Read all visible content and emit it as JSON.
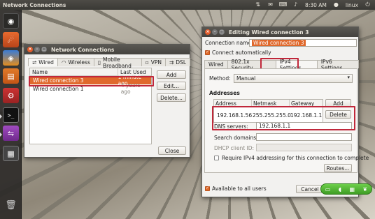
{
  "top_panel": {
    "title": "Network Connections",
    "time": "8:30 AM",
    "user": "linux"
  },
  "nc_window": {
    "title": "Network Connections",
    "tabs": [
      "Wired",
      "Wireless",
      "Mobile Broadband",
      "VPN",
      "DSL"
    ],
    "columns": [
      "Name",
      "Last Used"
    ],
    "rows": [
      {
        "name": "Wired connection 3",
        "last_used": "1 minute ago",
        "selected": true
      },
      {
        "name": "Wired connection 1",
        "last_used": "4 years ago",
        "selected": false
      }
    ],
    "buttons": {
      "add": "Add",
      "edit": "Edit...",
      "delete": "Delete...",
      "close": "Close"
    }
  },
  "edit_window": {
    "title": "Editing Wired connection 3",
    "connection_name_label": "Connection name:",
    "connection_name": "Wired connection 3",
    "connect_auto": "Connect automatically",
    "tabs": [
      "Wired",
      "802.1x Security",
      "IPv4 Settings",
      "IPv6 Settings"
    ],
    "method_label": "Method:",
    "method_value": "Manual",
    "addresses_label": "Addresses",
    "addr_columns": [
      "Address",
      "Netmask",
      "Gateway"
    ],
    "addr_row": {
      "address": "192.168.1.56",
      "netmask": "255.255.255.0",
      "gateway": "192.168.1.1"
    },
    "add": "Add",
    "delete": "Delete",
    "dns_label": "DNS servers:",
    "dns_value": "192.168.1.1",
    "search_label": "Search domains:",
    "dhcp_label": "DHCP client ID:",
    "require_label": "Require IPv4 addressing for this connection to complete",
    "routes": "Routes...",
    "available_label": "Available to all users",
    "cancel": "Cancel"
  },
  "colors": {
    "highlight": "#c0273a",
    "selection": "#e0692c",
    "panel": "#3d3b37"
  }
}
